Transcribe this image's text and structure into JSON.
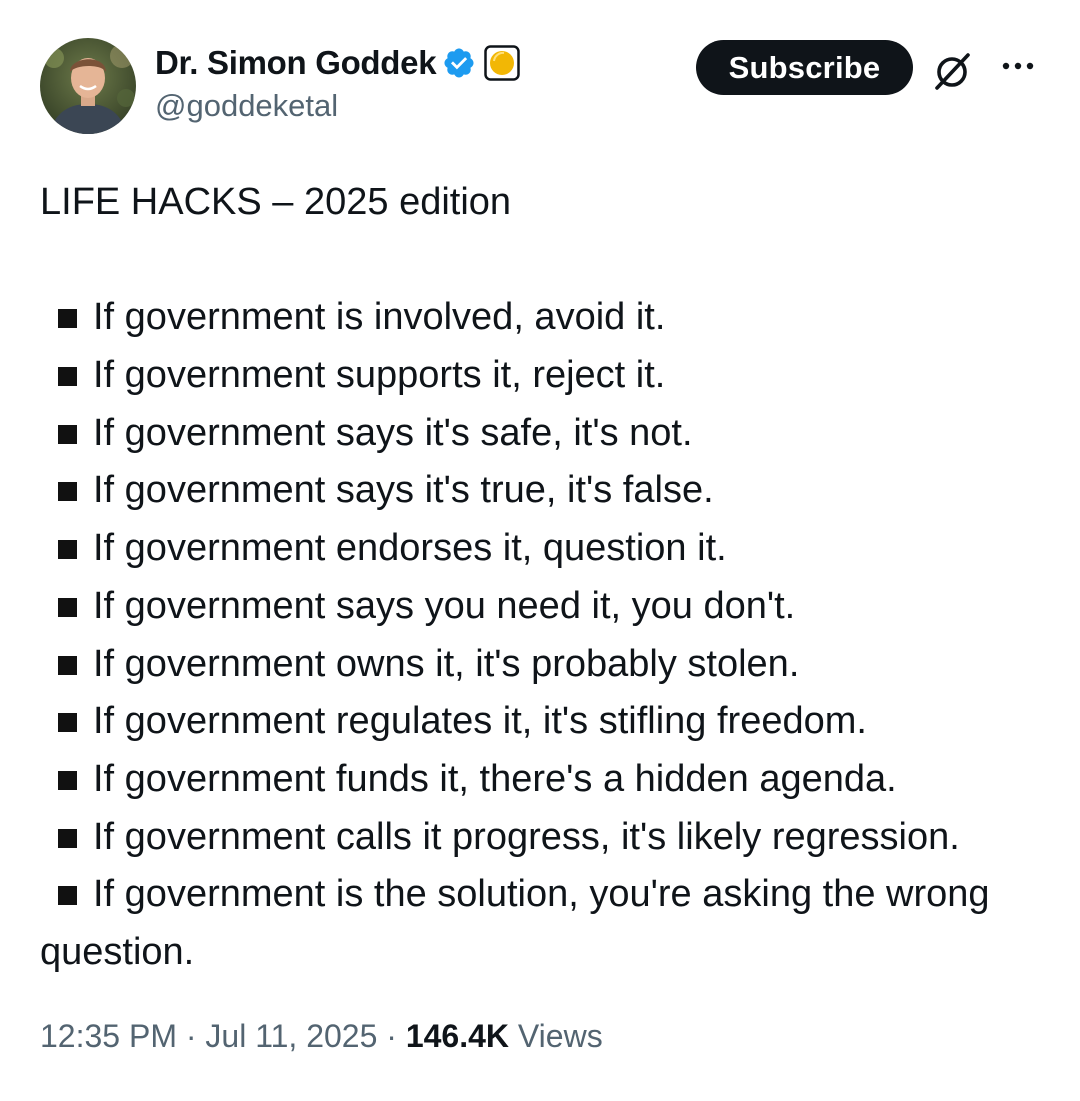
{
  "author": {
    "display_name": "Dr. Simon Goddek",
    "handle": "@goddeketal"
  },
  "actions": {
    "subscribe_label": "Subscribe"
  },
  "tweet": {
    "headline": "LIFE HACKS – 2025 edition",
    "hacks": [
      "If government is involved, avoid it.",
      "If government supports it, reject it.",
      "If government says it's safe, it's not.",
      "If government says it's true, it's false.",
      "If government endorses it, question it.",
      "If government says you need it, you don't.",
      "If government owns it, it's probably stolen.",
      "If government regulates it, it's stifling freedom.",
      "If government funds it, there's a hidden agenda.",
      "If government calls it progress, it's likely regression.",
      "If government is the solution, you're asking the wrong question."
    ]
  },
  "meta": {
    "time": "12:35 PM",
    "date": "Jul 11, 2025",
    "separator": "·",
    "views_count": "146.4K",
    "views_label": "Views"
  },
  "icons": {
    "verified": "verified-badge-icon",
    "affiliate": "affiliate-badge-icon",
    "grok": "grok-icon",
    "more": "more-options-icon"
  },
  "colors": {
    "text": "#0f1419",
    "secondary": "#536471",
    "verified_blue": "#1d9bf0",
    "button_bg": "#0f1419",
    "button_text": "#ffffff"
  }
}
